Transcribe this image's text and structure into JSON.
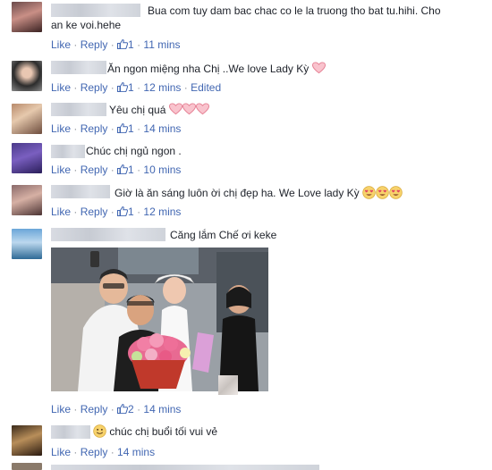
{
  "actions": {
    "like": "Like",
    "reply": "Reply",
    "separator": " · ",
    "edited": "Edited"
  },
  "colors": {
    "link": "#4267b2",
    "meta": "#90949c",
    "text": "#1d2129",
    "heart": "#f28ca0"
  },
  "comments": [
    {
      "text": "Bua com tuy dam bac chac co le la truong tho bat tu.hihi. Cho an ke voi.hehe",
      "likes": "1",
      "time": "11 mins",
      "edited": false
    },
    {
      "text": "Ăn ngon miệng nha Chị ..We love Lady Kỳ",
      "likes": "1",
      "time": "12 mins",
      "edited": true,
      "emoji": "heart"
    },
    {
      "text": "Yêu chị quá",
      "likes": "1",
      "time": "14 mins",
      "emoji": "hearts-3"
    },
    {
      "text": "Chúc chị ngủ ngon .",
      "likes": "1",
      "time": "10 mins"
    },
    {
      "text": "Giờ là ăn sáng luôn ời chị đẹp ha. We Love lady Kỳ",
      "likes": "1",
      "time": "12 mins",
      "emoji": "heart-eyes-3"
    },
    {
      "text": "Căng lắm Chế ơi keke",
      "likes": "2",
      "time": "14 mins",
      "attachment": "photo"
    },
    {
      "text": "chúc chị buổi tối vui vẻ",
      "time": "14 mins",
      "emoji": "smile"
    }
  ]
}
